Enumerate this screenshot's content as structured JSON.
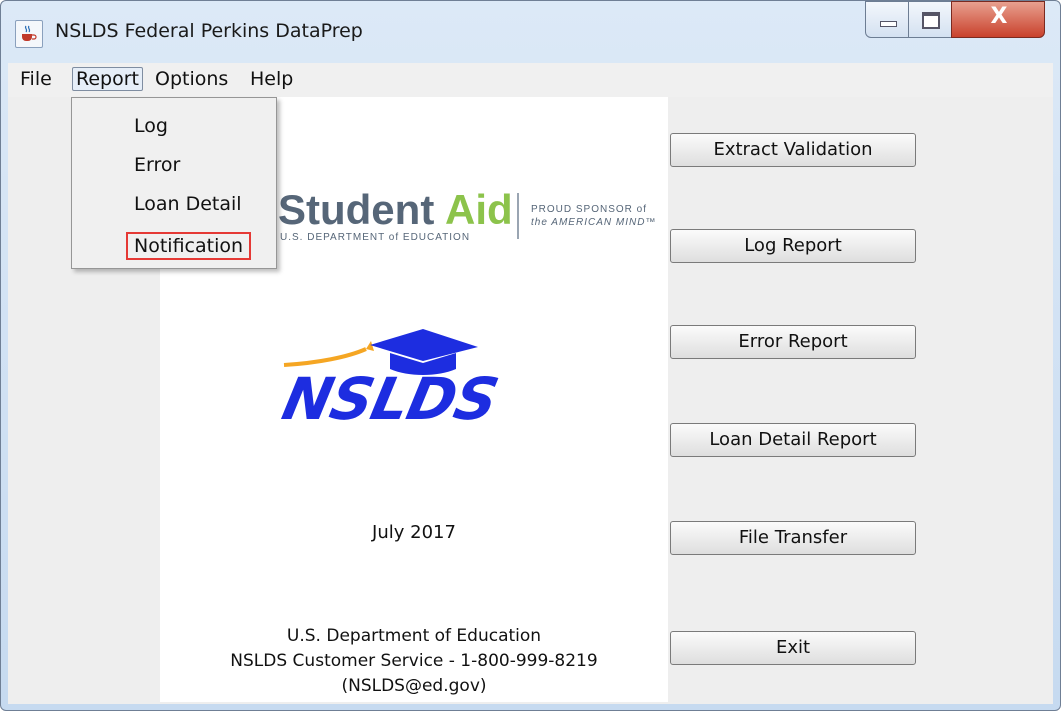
{
  "window": {
    "title": "NSLDS Federal Perkins DataPrep",
    "close_glyph": "X",
    "icons": [
      "java-app-icon",
      "minimize-icon",
      "maximize-icon",
      "close-icon"
    ]
  },
  "menubar": {
    "items": [
      {
        "label": "File"
      },
      {
        "label": "Report"
      },
      {
        "label": "Options"
      },
      {
        "label": "Help"
      }
    ]
  },
  "report_menu": {
    "items": [
      {
        "label": "Log"
      },
      {
        "label": "Error"
      },
      {
        "label": "Loan Detail"
      },
      {
        "label": "Notification"
      }
    ],
    "highlight_color": "#e53935"
  },
  "logos": {
    "fsa": {
      "word1": "Student",
      "word2": "Aid",
      "subtitle": "U.S. DEPARTMENT of EDUCATION",
      "sponsor_line1": "PROUD SPONSOR of",
      "sponsor_line2": "the AMERICAN MIND™",
      "colors": {
        "gray": "#566678",
        "green": "#8cc34b"
      }
    },
    "nslds": {
      "text": "NSLDS",
      "colors": {
        "blue": "#1d2de0",
        "orange": "#f5a623"
      }
    }
  },
  "content": {
    "date": "July 2017",
    "footer_lines": [
      "U.S. Department of Education",
      "NSLDS Customer Service - 1-800-999-8219",
      "(NSLDS@ed.gov)"
    ]
  },
  "buttons": [
    {
      "label": "Extract Validation"
    },
    {
      "label": "Log Report"
    },
    {
      "label": "Error Report"
    },
    {
      "label": "Loan Detail Report"
    },
    {
      "label": "File Transfer"
    },
    {
      "label": "Exit"
    }
  ]
}
